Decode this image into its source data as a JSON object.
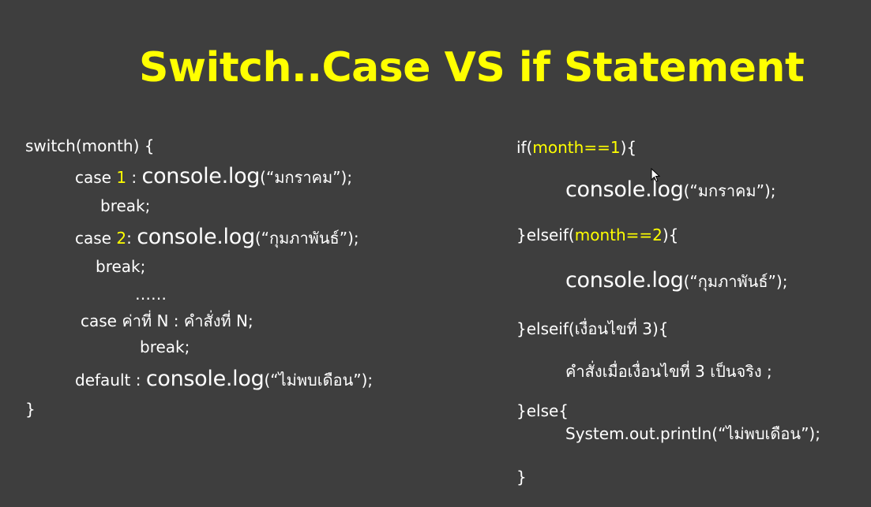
{
  "slide": {
    "title": "Switch..Case VS if Statement",
    "colors": {
      "background": "#3e3e3e",
      "title": "#ffff00",
      "text": "#ffffff",
      "highlight": "#ffff00"
    }
  },
  "switch_code": {
    "open": "switch(month) {",
    "case1_prefix": "case ",
    "case1_num": "1",
    "case1_sep": " : ",
    "case1_call": "console.log",
    "case1_arg": "(“มกราคม”);",
    "break1": "break;",
    "case2_prefix": "case ",
    "case2_num": "2",
    "case2_sep": ": ",
    "case2_call": "console.log",
    "case2_arg": "(“กุมภาพันธ์”);",
    "break2": "break;",
    "ellipsis": "……",
    "caseN": "case ค่าที่ N : คำสั่งที่ N;",
    "breakN": "break;",
    "default_prefix": "default : ",
    "default_call": "console.log",
    "default_arg": "(“ไม่พบเดือน”);",
    "close": "}"
  },
  "if_code": {
    "if_prefix": "if(",
    "if_cond": "month==1",
    "if_suffix": "){",
    "if_call": "console.log",
    "if_arg": "(“มกราคม”);",
    "elseif1_prefix": "}elseif(",
    "elseif1_cond": "month==2",
    "elseif1_suffix": "){",
    "elseif1_call": "console.log",
    "elseif1_arg": "(“กุมภาพันธ์”);",
    "elseif2": "}elseif(เงื่อนไขที่ 3){",
    "elseif2_body": "คำสั่งเมื่อเงื่อนไขที่ 3 เป็นจริง ;",
    "else": "}else{",
    "else_body": "System.out.println(“ไม่พบเดือน”);",
    "close": "}"
  }
}
